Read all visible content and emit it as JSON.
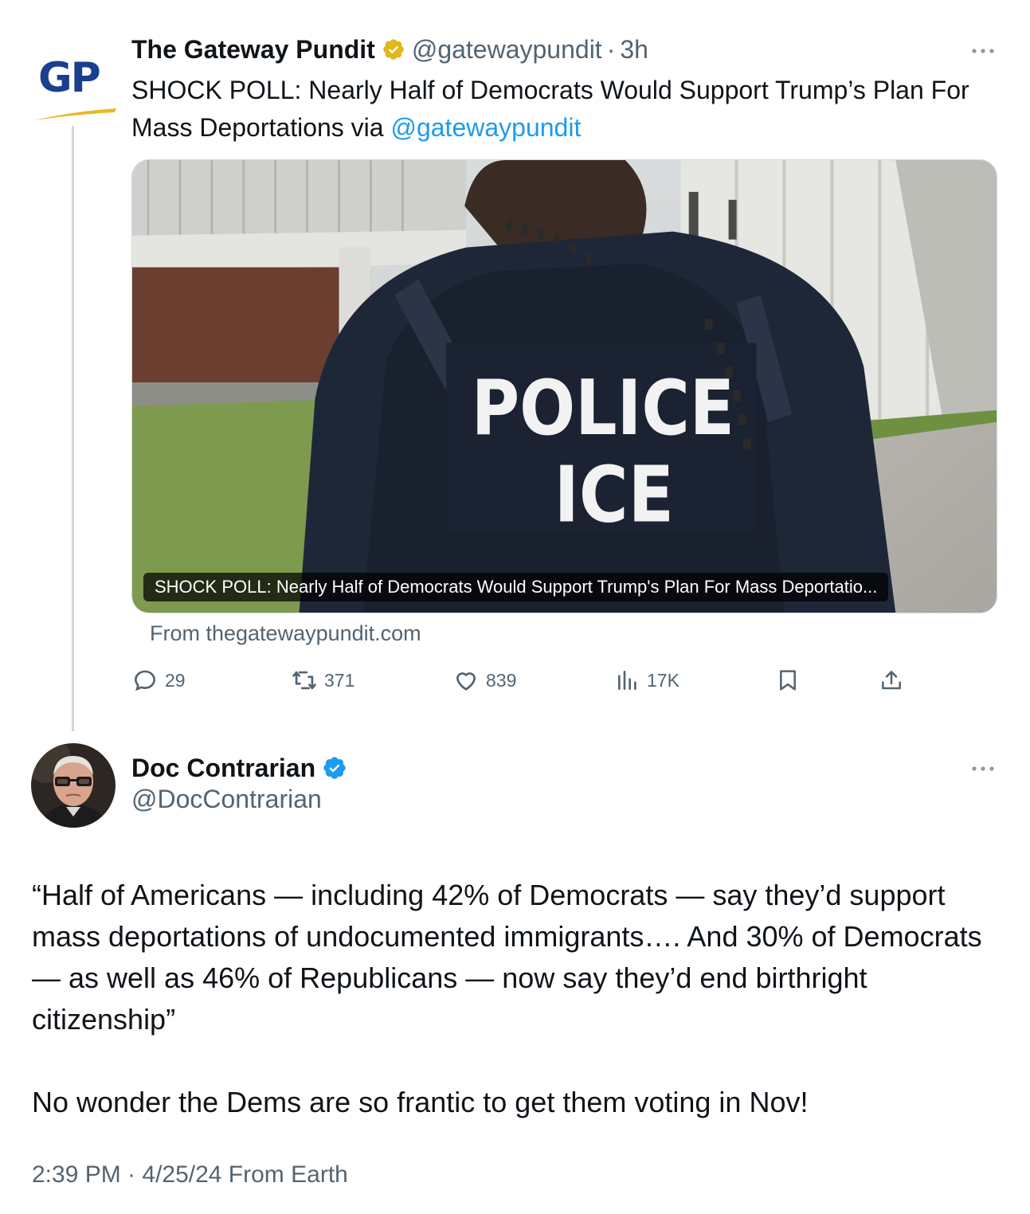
{
  "parent_tweet": {
    "avatar_text": "GP",
    "display_name": "The Gateway Pundit",
    "handle": "@gatewaypundit",
    "separator": "·",
    "time": "3h",
    "text_main": "SHOCK POLL: Nearly Half of Democrats Would Support Trump’s Plan For Mass Deportations via ",
    "text_mention": "@gatewaypundit",
    "card": {
      "image_patch_line1": "POLICE",
      "image_patch_line2": "ICE",
      "caption": "SHOCK POLL: Nearly Half of Democrats Would Support Trump's Plan For Mass Deportatio...",
      "source": "From thegatewaypundit.com"
    },
    "stats": {
      "replies": "29",
      "reposts": "371",
      "likes": "839",
      "views": "17K"
    },
    "icons": [
      "gold-verified-badge-icon",
      "more-icon",
      "reply-icon",
      "repost-icon",
      "like-icon",
      "views-icon",
      "bookmark-icon",
      "share-icon"
    ]
  },
  "main_tweet": {
    "display_name": "Doc Contrarian",
    "handle": "@DocContrarian",
    "paragraph1": "“Half of Americans — including 42% of Democrats — say they’d support mass deportations of undocumented immigrants…. And 30% of Democrats — as well as 46% of Republicans — now say they’d end birthright citizenship”",
    "paragraph2": "No wonder the Dems are so frantic to get them voting in Nov!",
    "timestamp": "2:39 PM · 4/25/24 From Earth",
    "icons": [
      "blue-verified-badge-icon",
      "more-icon"
    ]
  },
  "colors": {
    "link": "#1d9bf0",
    "secondary_text": "#536471",
    "gp_blue": "#1a3f8f",
    "gp_gold": "#e8b923",
    "verified_blue": "#1d9bf0",
    "verified_gold": "#e2b719"
  }
}
